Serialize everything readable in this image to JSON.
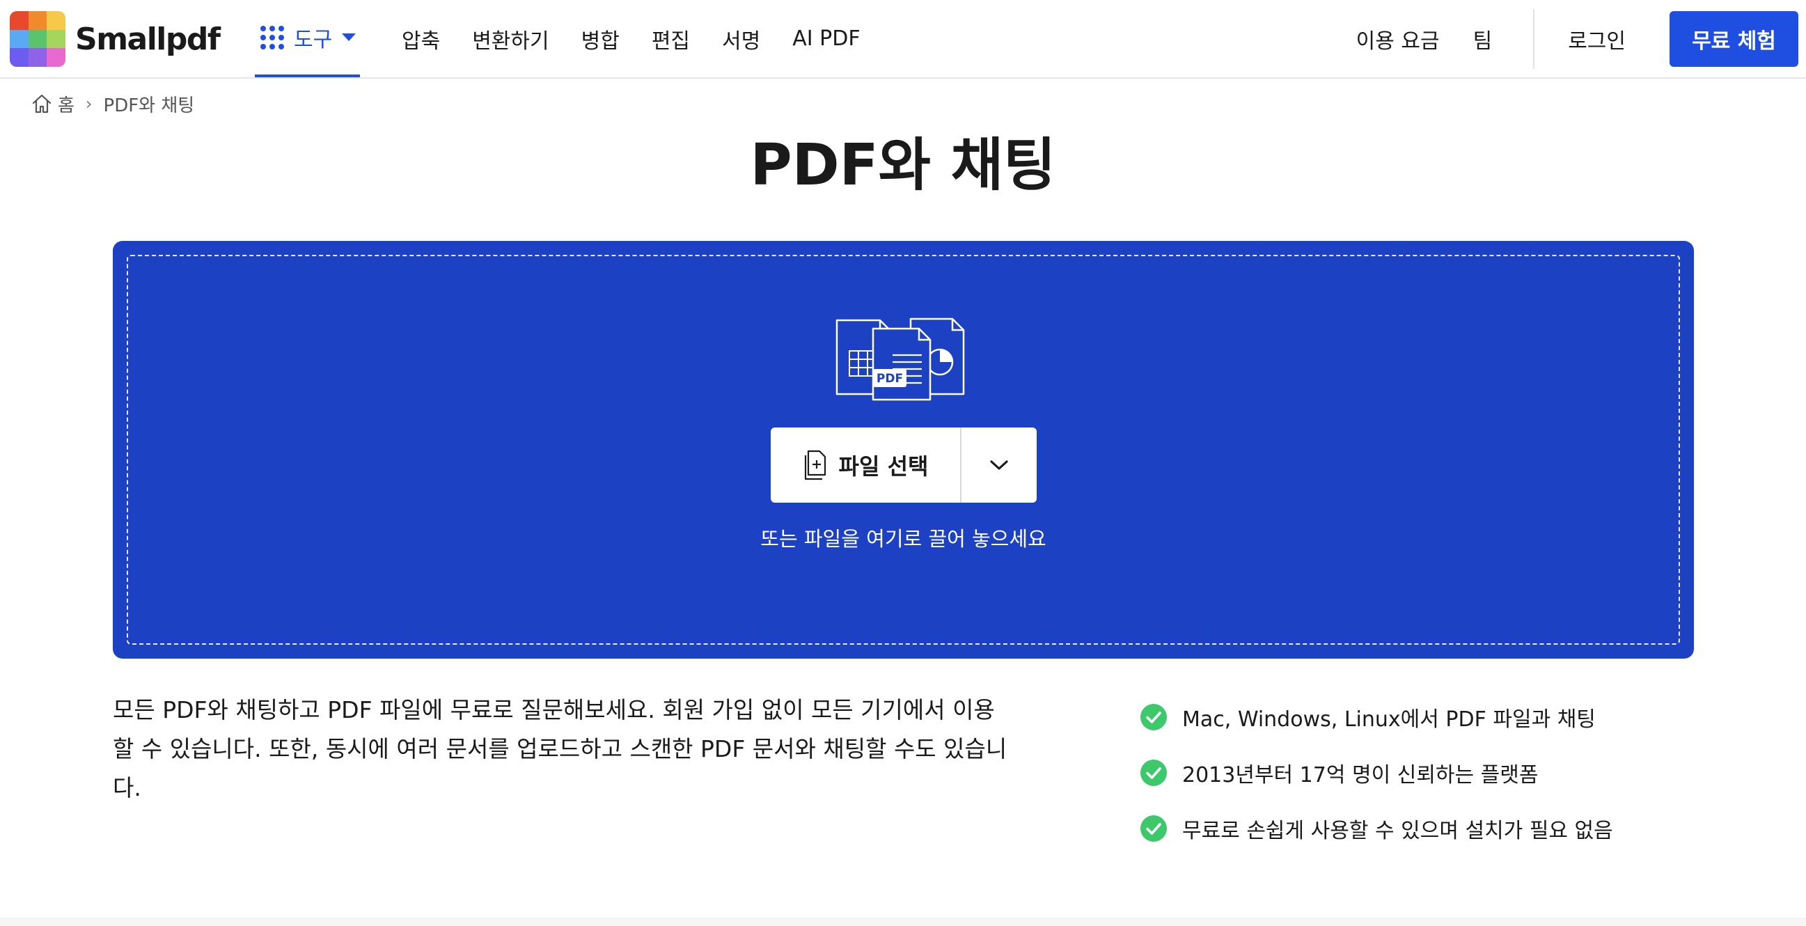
{
  "brand": {
    "name": "Smallpdf",
    "logo_colors": [
      "#e6492b",
      "#f08a2c",
      "#f7c948",
      "#5aa9f5",
      "#5bc36b",
      "#a4d65e",
      "#6d5cf0",
      "#8e63e8",
      "#e86ad1"
    ]
  },
  "header": {
    "tools_label": "도구",
    "nav_items": [
      "압축",
      "변환하기",
      "병합",
      "편집",
      "서명",
      "AI PDF"
    ],
    "pricing_label": "이용 요금",
    "team_label": "팀",
    "login_label": "로그인",
    "trial_label": "무료 체험"
  },
  "breadcrumb": {
    "home_label": "홈",
    "separator": "›",
    "current": "PDF와 채팅"
  },
  "main": {
    "title": "PDF와 채팅",
    "dropzone": {
      "illustration_badge": "PDF",
      "choose_file_label": "파일 선택",
      "drop_hint": "또는 파일을 여기로 끌어 놓으세요"
    },
    "description": "모든 PDF와 채팅하고 PDF 파일에 무료로 질문해보세요. 회원 가입 없이 모든 기기에서 이용할 수 있습니다. 또한, 동시에 여러 문서를 업로드하고 스캔한 PDF 문서와 채팅할 수도 있습니다.",
    "features": [
      "Mac, Windows, Linux에서 PDF 파일과 채팅",
      "2013년부터 17억 명이 신뢰하는 플랫폼",
      "무료로 손쉽게 사용할 수 있으며 설치가 필요 없음"
    ]
  },
  "colors": {
    "accent": "#1e4fe0",
    "dropzone_bg": "#1d41c3",
    "check_green": "#3cc86b"
  },
  "icons": [
    "grid-icon",
    "caret-down-icon",
    "home-icon",
    "file-stack-icon",
    "file-add-icon",
    "chevron-down-icon",
    "check-circle-icon"
  ]
}
